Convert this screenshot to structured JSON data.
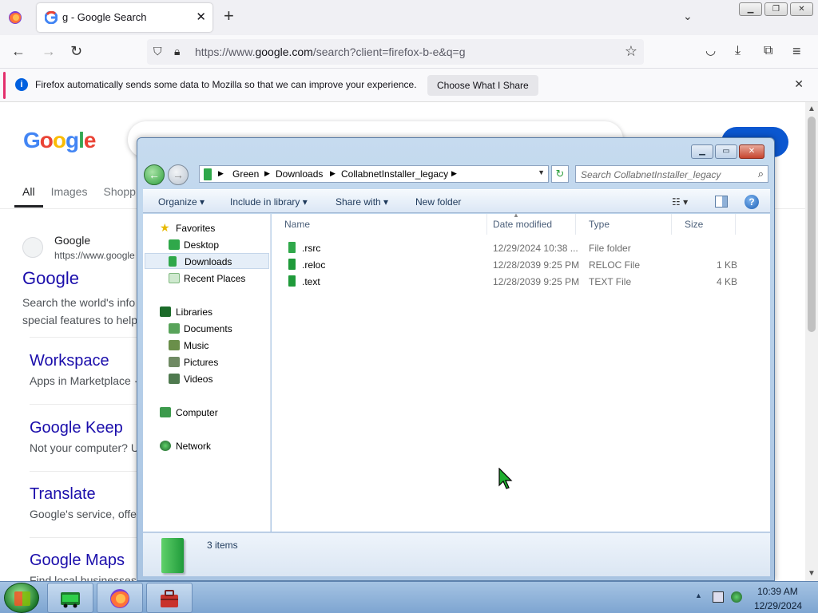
{
  "browser": {
    "tab_title": "g - Google Search",
    "tab_close": "✕",
    "new_tab": "+",
    "tab_list": "⌄",
    "url_prefix": "https://www.",
    "url_domain": "google.com",
    "url_rest": "/search?client=firefox-b-e&q=g",
    "notification": "Firefox automatically sends some data to Mozilla so that we can improve your experience.",
    "notification_button": "Choose What I Share",
    "window_buttons": [
      "▁",
      "❐",
      "✕"
    ]
  },
  "google": {
    "logo_letters": [
      "G",
      "o",
      "o",
      "g",
      "l",
      "e"
    ],
    "tabs": [
      "All",
      "Images",
      "Shopp"
    ],
    "result": {
      "site_name": "Google",
      "site_url": "https://www.google",
      "title": "Google",
      "snippet_line1": "Search the world's info",
      "snippet_line2": "special features to help"
    },
    "sublinks": [
      {
        "title": "Workspace",
        "desc": "Apps in Marketplace ·"
      },
      {
        "title": "Google Keep",
        "desc": "Not your computer? U"
      },
      {
        "title": "Translate",
        "desc": "Google's service, offe"
      },
      {
        "title": "Google Maps",
        "desc": "Find local businesses"
      }
    ]
  },
  "explorer": {
    "breadcrumbs": [
      "Green",
      "Downloads",
      "CollabnetInstaller_legacy"
    ],
    "search_placeholder": "Search CollabnetInstaller_legacy",
    "toolbar": {
      "organize": "Organize ▾",
      "include": "Include in library ▾",
      "share": "Share with ▾",
      "new_folder": "New folder"
    },
    "nav": {
      "favorites": "Favorites",
      "desktop": "Desktop",
      "downloads": "Downloads",
      "recent": "Recent Places",
      "libraries": "Libraries",
      "documents": "Documents",
      "music": "Music",
      "pictures": "Pictures",
      "videos": "Videos",
      "computer": "Computer",
      "network": "Network"
    },
    "columns": {
      "name": "Name",
      "date": "Date modified",
      "type": "Type",
      "size": "Size"
    },
    "files": [
      {
        "name": ".rsrc",
        "date": "12/29/2024 10:38 ...",
        "type": "File folder",
        "size": ""
      },
      {
        "name": ".reloc",
        "date": "12/28/2039 9:25 PM",
        "type": "RELOC File",
        "size": "1 KB"
      },
      {
        "name": ".text",
        "date": "12/28/2039 9:25 PM",
        "type": "TEXT File",
        "size": "4 KB"
      }
    ],
    "item_count": "3 items"
  },
  "taskbar": {
    "time": "10:39 AM",
    "date": "12/29/2024"
  },
  "colors": {
    "folder_green": "#2fa84a",
    "link_blue": "#1a0dab",
    "google_button": "#0b57d0"
  }
}
